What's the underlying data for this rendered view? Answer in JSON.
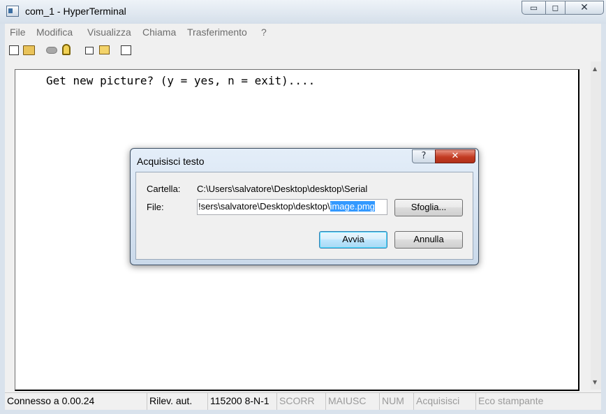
{
  "window": {
    "title": "com_1 - HyperTerminal",
    "min_glyph": "▭",
    "max_glyph": "◻",
    "close_glyph": "✕"
  },
  "menu": [
    "File",
    "Modifica",
    "Visualizza",
    "Chiama",
    "Trasferimento",
    "?"
  ],
  "toolbar": [
    "new-icon",
    "open-icon",
    "disconnect-icon",
    "connect-icon",
    "send-icon",
    "receive-icon",
    "properties-icon"
  ],
  "terminal": {
    "text": "Get new picture? (y = yes, n = exit)...."
  },
  "status": {
    "connected": "Connesso a 0.00.24",
    "detect": "Rilev. aut.",
    "settings": "115200 8-N-1",
    "scroll": "SCORR",
    "caps": "MAIUSC",
    "num": "NUM",
    "capture": "Acquisisci",
    "echo": "Eco stampante"
  },
  "dialog": {
    "title": "Acquisisci testo",
    "help_glyph": "?",
    "close_glyph": "✕",
    "folder_label": "Cartella:",
    "folder_value": "C:\\Users\\salvatore\\Desktop\\desktop\\Serial",
    "file_label": "File:",
    "file_value_prefix": "!sers\\salvatore\\Desktop\\desktop\\",
    "file_value_selected": "image.pmg",
    "browse_label": "Sfoglia...",
    "start_label": "Avvia",
    "cancel_label": "Annulla"
  },
  "colors": {
    "selection": "#3399ff",
    "close_red": "#c23b22"
  }
}
